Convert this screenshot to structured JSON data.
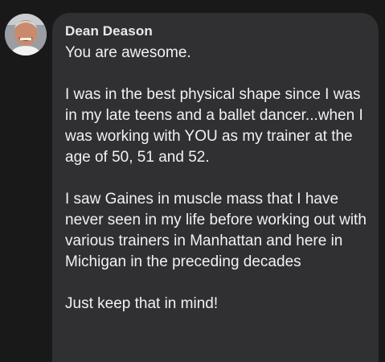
{
  "comment": {
    "author": "Dean Deason",
    "paragraphs": [
      "You are awesome.",
      "I was in the best physical shape since I was in my late teens and a ballet dancer...when I was working with YOU as my trainer at the age of 50, 51 and 52.",
      "I saw Gaines in muscle mass that I have never seen in my life before working out with various trainers in Manhattan and here in Michigan in the preceding decades",
      "Just keep that in mind!"
    ]
  },
  "colors": {
    "background": "#19191a",
    "bubble": "#303032",
    "text": "#f1f1f2"
  }
}
